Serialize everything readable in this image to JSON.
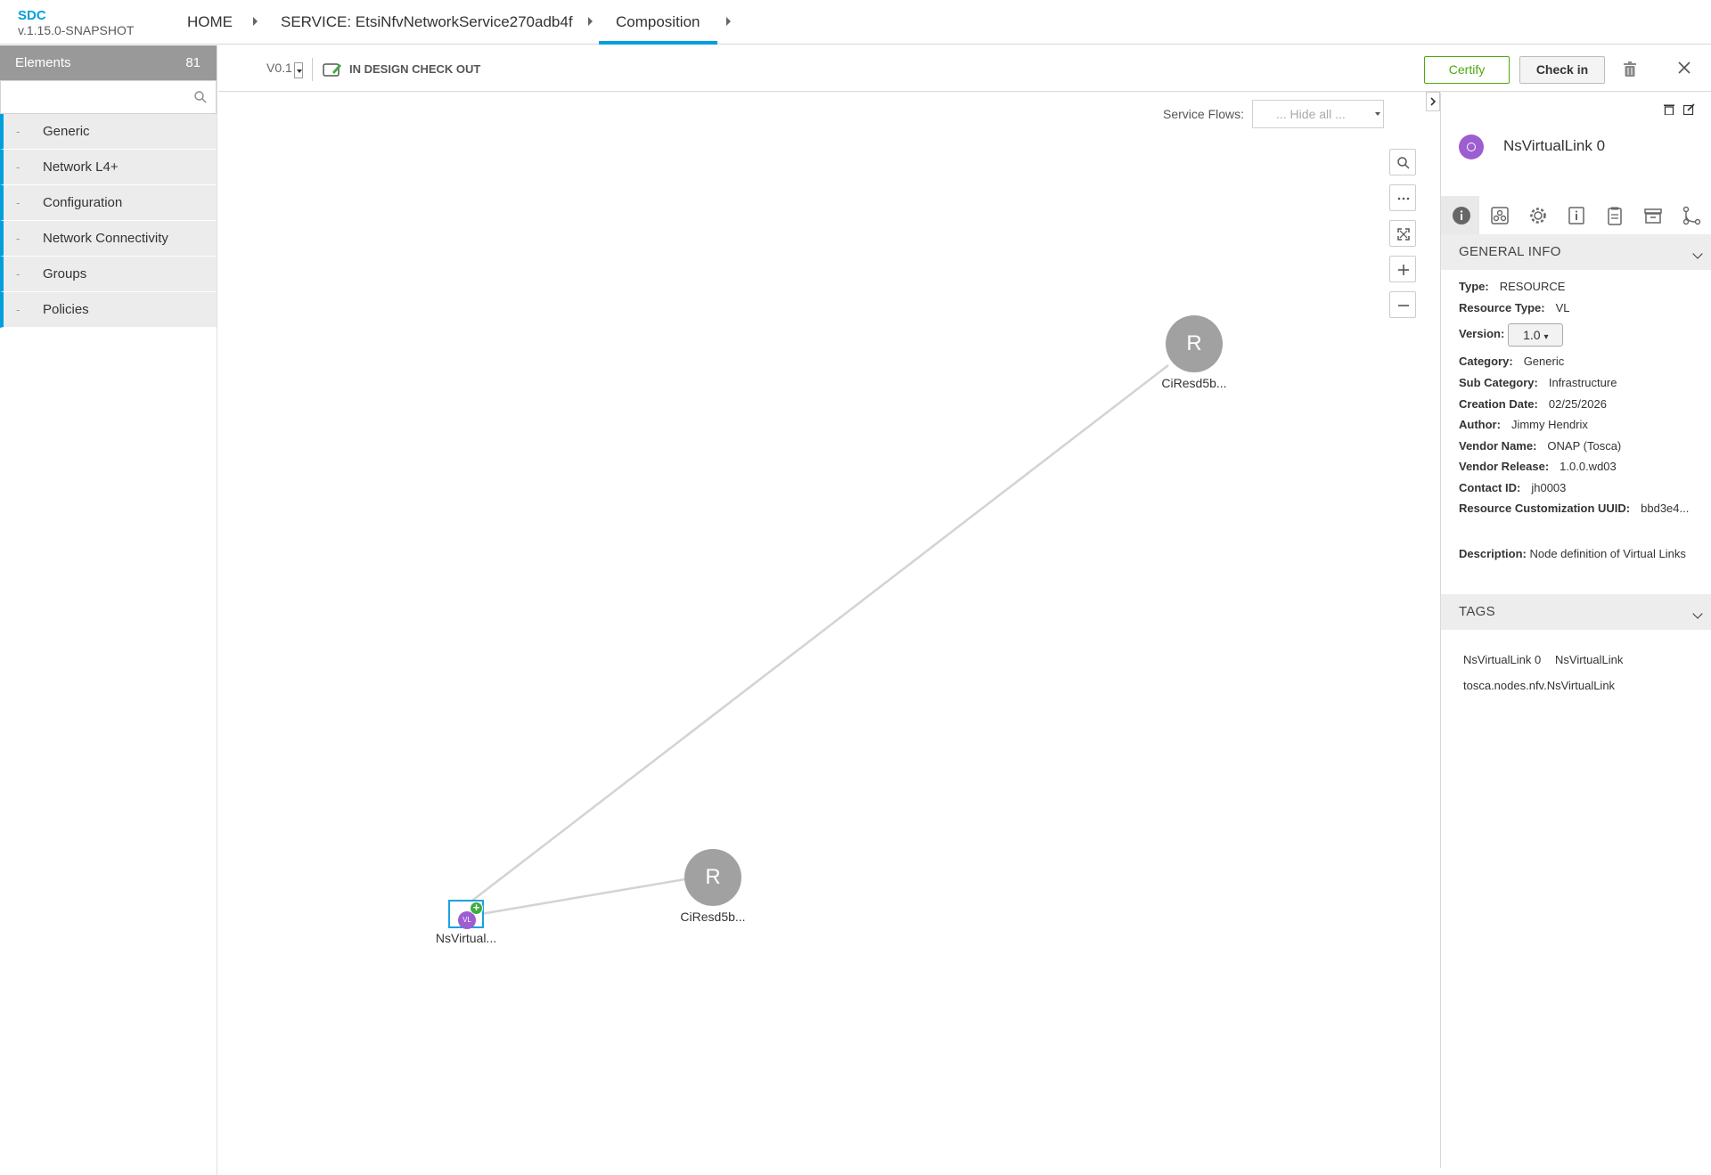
{
  "app": {
    "name": "SDC",
    "version": "v.1.15.0-SNAPSHOT"
  },
  "breadcrumb": {
    "home": "HOME",
    "service": "SERVICE: EtsiNfvNetworkService270adb4f",
    "current": "Composition"
  },
  "palette": {
    "title": "Elements",
    "count": "81",
    "search_placeholder": "",
    "groups": [
      {
        "label": "Generic"
      },
      {
        "label": "Network L4+"
      },
      {
        "label": "Configuration"
      },
      {
        "label": "Network Connectivity"
      },
      {
        "label": "Groups"
      },
      {
        "label": "Policies"
      }
    ],
    "group_bullet": "-"
  },
  "toolbar": {
    "version": "V0.1",
    "lifecycle": "IN DESIGN CHECK OUT",
    "certify_label": "Certify",
    "checkin_label": "Check in"
  },
  "canvas": {
    "service_flows_label": "Service Flows:",
    "service_flows_value": "... Hide all ...",
    "nodes": [
      {
        "letter": "R",
        "label": "CiResd5b..."
      },
      {
        "letter": "R",
        "label": "CiResd5b..."
      },
      {
        "letter": "VL",
        "label": "NsVirtual..."
      }
    ]
  },
  "details": {
    "title": "NsVirtualLink 0",
    "general_info_header": "GENERAL INFO",
    "type_label": "Type:",
    "type": "RESOURCE",
    "resource_type_label": "Resource Type:",
    "resource_type": "VL",
    "version_label": "Version:",
    "version": "1.0",
    "category_label": "Category:",
    "category": "Generic",
    "sub_category_label": "Sub Category:",
    "sub_category": "Infrastructure",
    "creation_date_label": "Creation Date:",
    "creation_date": "02/25/2026",
    "author_label": "Author:",
    "author": "Jimmy Hendrix",
    "vendor_name_label": "Vendor Name:",
    "vendor_name": "ONAP (Tosca)",
    "vendor_release_label": "Vendor Release:",
    "vendor_release": "1.0.0.wd03",
    "contact_id_label": "Contact ID:",
    "contact_id": "jh0003",
    "customization_uuid_label": "Resource Customization UUID:",
    "customization_uuid": "bbd3e4...",
    "description_label": "Description:",
    "description": "Node definition of Virtual Links",
    "tags_header": "TAGS",
    "tags": [
      "NsVirtualLink 0",
      "NsVirtualLink",
      "tosca.nodes.nfv.NsVirtualLink"
    ]
  },
  "colors": {
    "accent": "#009fdb",
    "certify": "#4ca90c",
    "node_gray": "#a1a1a1",
    "vl_purple": "#9c5ed1",
    "plus_green": "#3dad3d"
  }
}
